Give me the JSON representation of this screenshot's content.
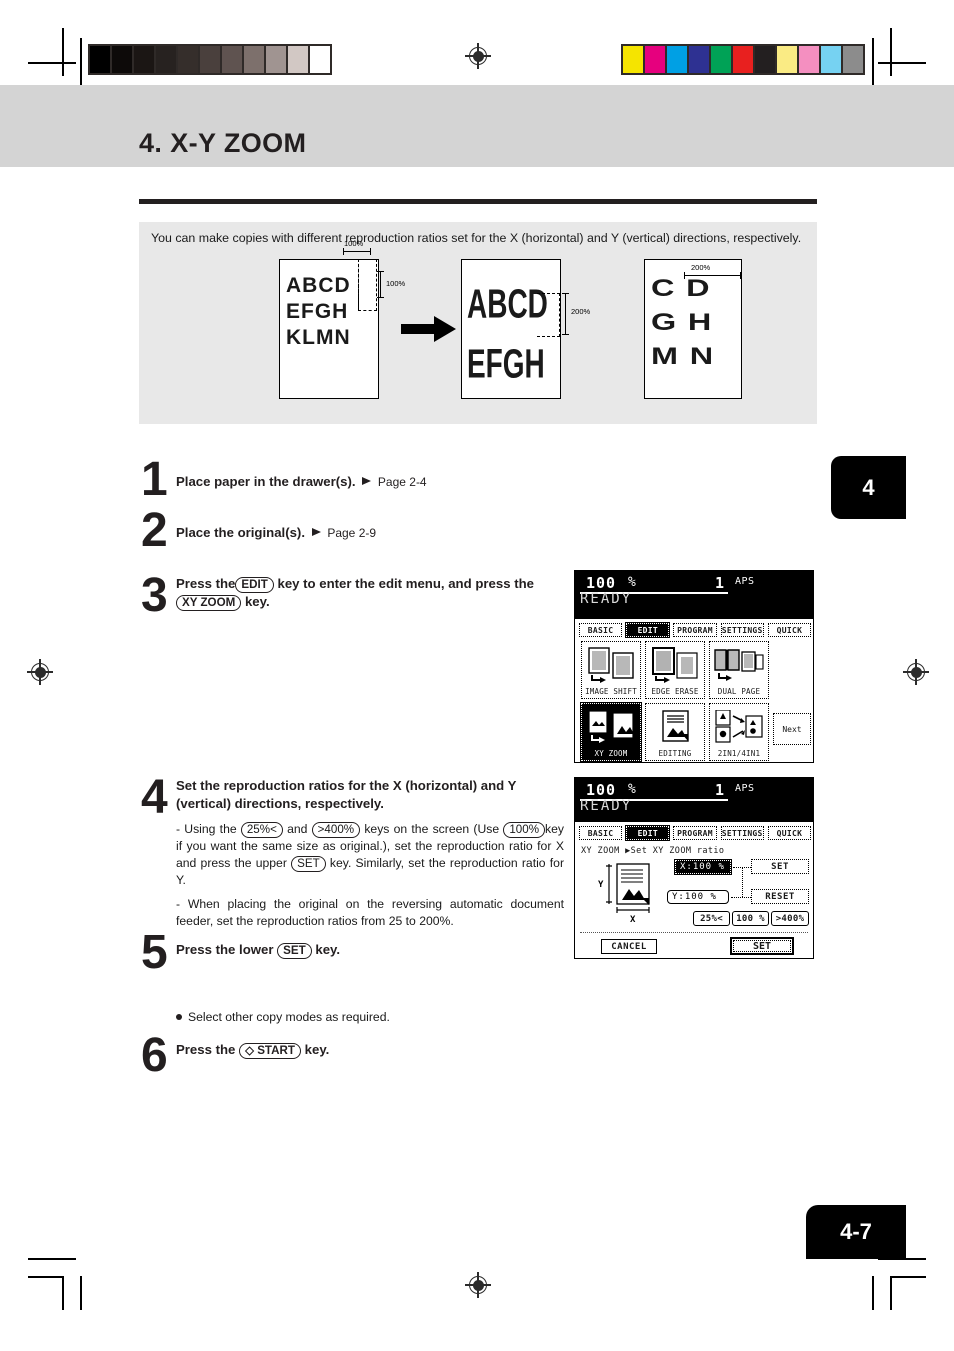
{
  "page": {
    "chapter_title": "4. X-Y ZOOM",
    "chapter_tab": "4",
    "page_number": "4-7"
  },
  "intro": {
    "text": "You can make copies with different reproduction ratios set for the X (horizontal) and Y (vertical) directions, respectively."
  },
  "illustration": {
    "original": {
      "lines": [
        "ABCD",
        "EFGH",
        "KLMN"
      ],
      "label_x": "100%",
      "label_y": "100%"
    },
    "result": {
      "lines": [
        "ABCD",
        "EFGH"
      ],
      "label_y": "200%"
    },
    "result2": {
      "lines": [
        "C D",
        "G H",
        "M N"
      ],
      "label_x": "200%"
    }
  },
  "steps": [
    {
      "num": "1",
      "head": "Place paper in the drawer(s).",
      "ref": "Page 2-4"
    },
    {
      "num": "2",
      "head": "Place the original(s).",
      "ref": "Page 2-9"
    },
    {
      "num": "3",
      "head_a": "Press the",
      "key_edit": "EDIT",
      "head_b": "key to enter the edit menu, and press",
      "head_c": "the",
      "key_xyzoom": "XY ZOOM",
      "head_d": "key."
    },
    {
      "num": "4",
      "head": "Set the reproduction ratios for the X (horizontal) and Y (vertical) directions, respectively.",
      "b1_a": "- Using the",
      "b1_k1": "25%<",
      "b1_b": "and",
      "b1_k2": ">400%",
      "b1_c": "keys on the screen (Use",
      "b1_k3": "100%",
      "b1_d": "key if you want the same size as original.), set the reproduction ratio for X and press the upper",
      "b1_k4": "SET",
      "b1_e": "key. Similarly, set the reproduction ratio for Y.",
      "b2": "-  When placing the original on the reversing automatic document feeder, set the reproduction ratios from 25 to 200%."
    },
    {
      "num": "5",
      "head_a": "Press the lower",
      "key_set": "SET",
      "head_b": "key.",
      "note": "Select other copy modes as required."
    },
    {
      "num": "6",
      "head_a": "Press the",
      "key_start": "◇ START",
      "head_b": "key."
    }
  ],
  "lcd1": {
    "ratio": "100",
    "percent": "%",
    "copies": "1",
    "paper": "APS",
    "status": "READY",
    "tabs": [
      {
        "label": "BASIC",
        "selected": false
      },
      {
        "label": "EDIT",
        "selected": true
      },
      {
        "label": "PROGRAM",
        "selected": false
      },
      {
        "label": "SETTINGS",
        "selected": false
      },
      {
        "label": "QUICK",
        "selected": false
      }
    ],
    "functions": [
      {
        "label": "IMAGE SHIFT",
        "icon": "image-shift-icon",
        "selected": false
      },
      {
        "label": "EDGE ERASE",
        "icon": "edge-erase-icon",
        "selected": false
      },
      {
        "label": "DUAL  PAGE",
        "icon": "dual-page-icon",
        "selected": false
      },
      {
        "label": "XY ZOOM",
        "icon": "xy-zoom-icon",
        "selected": true
      },
      {
        "label": "EDITING",
        "icon": "editing-icon",
        "selected": false
      },
      {
        "label": "2IN1/4IN1",
        "icon": "2in1-4in1-icon",
        "selected": false
      }
    ],
    "next_label": "Next"
  },
  "lcd2": {
    "ratio": "100",
    "percent": "%",
    "copies": "1",
    "paper": "APS",
    "status": "READY",
    "tabs": [
      {
        "label": "BASIC",
        "selected": false
      },
      {
        "label": "EDIT",
        "selected": true
      },
      {
        "label": "PROGRAM",
        "selected": false
      },
      {
        "label": "SETTINGS",
        "selected": false
      },
      {
        "label": "QUICK",
        "selected": false
      }
    ],
    "breadcrumb": "XY ZOOM  ▶Set XY ZOOM ratio",
    "field_x": "X:100   %",
    "field_y": "Y:100   %",
    "axis_y": "Y",
    "axis_x": "X",
    "btn_set_upper": "SET",
    "btn_reset": "RESET",
    "btn_25": "25%<",
    "btn_100": "100 %",
    "btn_400": ">400%",
    "btn_cancel": "CANCEL",
    "btn_set_lower": "SET"
  },
  "marks": {
    "grayscale": [
      "#000000",
      "#0d0a09",
      "#1b1614",
      "#272220",
      "#352e2b",
      "#4a403d",
      "#5f5350",
      "#7d706c",
      "#a09491",
      "#d2c8c4",
      "#ffffff"
    ],
    "colorbar": [
      "#f5e400",
      "#e6007e",
      "#00a0e4",
      "#2e3192",
      "#00a256",
      "#e8201f",
      "#231f20",
      "#faeb84",
      "#f48fc0",
      "#76d2f2",
      "#8c8c8c"
    ]
  }
}
